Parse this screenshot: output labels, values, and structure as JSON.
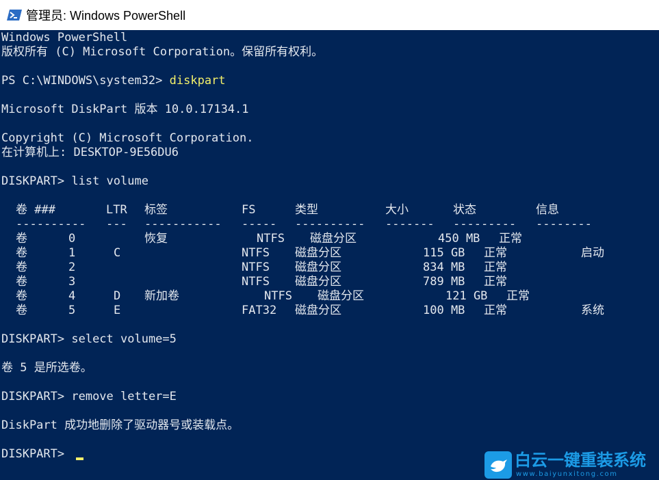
{
  "window": {
    "title": "管理员: Windows PowerShell",
    "background": "#012456",
    "text_color": "#e4e8ee",
    "command_color": "#f3f06a"
  },
  "console": {
    "header_line1": "Windows PowerShell",
    "header_line2": "版权所有 (C) Microsoft Corporation。保留所有权利。",
    "prompt1": "PS C:\\WINDOWS\\system32> ",
    "command1": "diskpart",
    "version_line": "Microsoft DiskPart 版本 10.0.17134.1",
    "copyright_line": "Copyright (C) Microsoft Corporation.",
    "computer_line": "在计算机上: DESKTOP-9E56DU6",
    "diskpart_prompt": "DISKPART> ",
    "command2": "list volume",
    "table": {
      "headers": {
        "vol": "卷 ###",
        "ltr": "LTR",
        "label": "标签",
        "fs": "FS",
        "type": "类型",
        "size": "大小",
        "status": "状态",
        "info": "信息"
      },
      "separators": {
        "vol": "----------",
        "ltr": "---",
        "label": "-----------",
        "fs": "-----",
        "type": "----------",
        "size": "-------",
        "status": "---------",
        "info": "--------"
      },
      "rows": [
        {
          "vol": "卷",
          "num": "0",
          "ltr": "",
          "label": "恢复",
          "fs": "NTFS",
          "type": "磁盘分区",
          "size": "450 MB",
          "status": "正常",
          "info": ""
        },
        {
          "vol": "卷",
          "num": "1",
          "ltr": "C",
          "label": "",
          "fs": "NTFS",
          "type": "磁盘分区",
          "size": "115 GB",
          "status": "正常",
          "info": "启动"
        },
        {
          "vol": "卷",
          "num": "2",
          "ltr": "",
          "label": "",
          "fs": "NTFS",
          "type": "磁盘分区",
          "size": "834 MB",
          "status": "正常",
          "info": ""
        },
        {
          "vol": "卷",
          "num": "3",
          "ltr": "",
          "label": "",
          "fs": "NTFS",
          "type": "磁盘分区",
          "size": "789 MB",
          "status": "正常",
          "info": ""
        },
        {
          "vol": "卷",
          "num": "4",
          "ltr": "D",
          "label": "新加卷",
          "fs": "NTFS",
          "type": "磁盘分区",
          "size": "121 GB",
          "status": "正常",
          "info": ""
        },
        {
          "vol": "卷",
          "num": "5",
          "ltr": "E",
          "label": "",
          "fs": "FAT32",
          "type": "磁盘分区",
          "size": "100 MB",
          "status": "正常",
          "info": "系统"
        }
      ]
    },
    "command3": "select volume=5",
    "select_result": "卷 5 是所选卷。",
    "command4": "remove letter=E",
    "remove_result": "DiskPart 成功地删除了驱动器号或装载点。"
  },
  "watermark": {
    "title": "白云一键重装系统",
    "url": "www.baiyunxitong.com"
  }
}
